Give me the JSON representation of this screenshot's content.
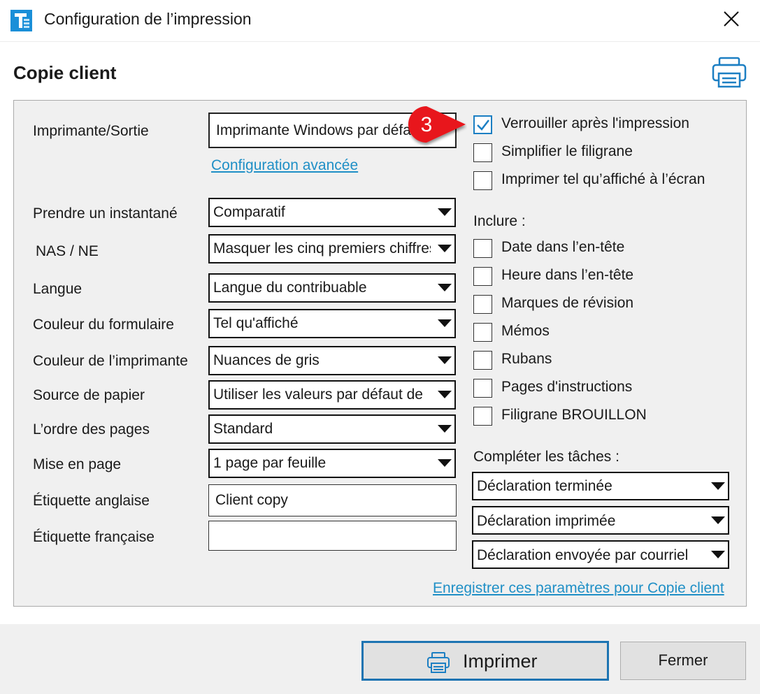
{
  "window": {
    "title": "Configuration de l’impression",
    "app_icon": "taxprep-app-icon",
    "close_icon": "close-icon"
  },
  "section": {
    "title": "Copie client",
    "print_icon": "printer-icon"
  },
  "form": {
    "printer": {
      "label": "Imprimante/Sortie",
      "value": "Imprimante Windows par défaut",
      "advanced_link": "Configuration avancée"
    },
    "fields": [
      {
        "label": "Prendre un instantané",
        "value": "Comparatif"
      },
      {
        "label": "NAS / NE",
        "value": "Masquer les cinq premiers chiffres"
      },
      {
        "label": "Langue",
        "value": "Langue du contribuable"
      },
      {
        "label": "Couleur du formulaire",
        "value": "Tel qu'affiché"
      },
      {
        "label": "Couleur de l’imprimante",
        "value": "Nuances de gris"
      },
      {
        "label": "Source de papier",
        "value": "Utiliser les valeurs par défaut de"
      },
      {
        "label": "L’ordre des pages",
        "value": "Standard"
      },
      {
        "label": "Mise en page",
        "value": "1 page par feuille"
      }
    ],
    "english_label": {
      "label": "Étiquette anglaise",
      "value": "Client copy"
    },
    "french_label": {
      "label": "Étiquette française",
      "value": ""
    }
  },
  "options": {
    "top": [
      {
        "label": "Verrouiller après l'impression",
        "checked": true
      },
      {
        "label": "Simplifier le filigrane",
        "checked": false
      },
      {
        "label": "Imprimer tel qu’affiché à l’écran",
        "checked": false
      }
    ],
    "include_title": "Inclure :",
    "include": [
      {
        "label": "Date dans l’en-tête",
        "checked": false
      },
      {
        "label": "Heure dans l’en-tête",
        "checked": false
      },
      {
        "label": "Marques de révision",
        "checked": false
      },
      {
        "label": "Mémos",
        "checked": false
      },
      {
        "label": "Rubans",
        "checked": false
      },
      {
        "label": "Pages d'instructions",
        "checked": false
      },
      {
        "label": "Filigrane BROUILLON",
        "checked": false
      }
    ],
    "tasks_title": "Compléter les tâches :",
    "tasks": [
      {
        "value": "Déclaration terminée"
      },
      {
        "value": "Déclaration imprimée"
      },
      {
        "value": "Déclaration envoyée par courriel"
      }
    ],
    "save_link": "Enregistrer ces paramètres pour Copie client"
  },
  "callout": {
    "number": "3",
    "color": "#e8161b"
  },
  "footer": {
    "print_label": "Imprimer",
    "print_icon": "printer-icon",
    "close_label": "Fermer"
  },
  "colors": {
    "link": "#1f8fc6",
    "accent": "#1d74b2",
    "panel": "#f0f0f0"
  }
}
